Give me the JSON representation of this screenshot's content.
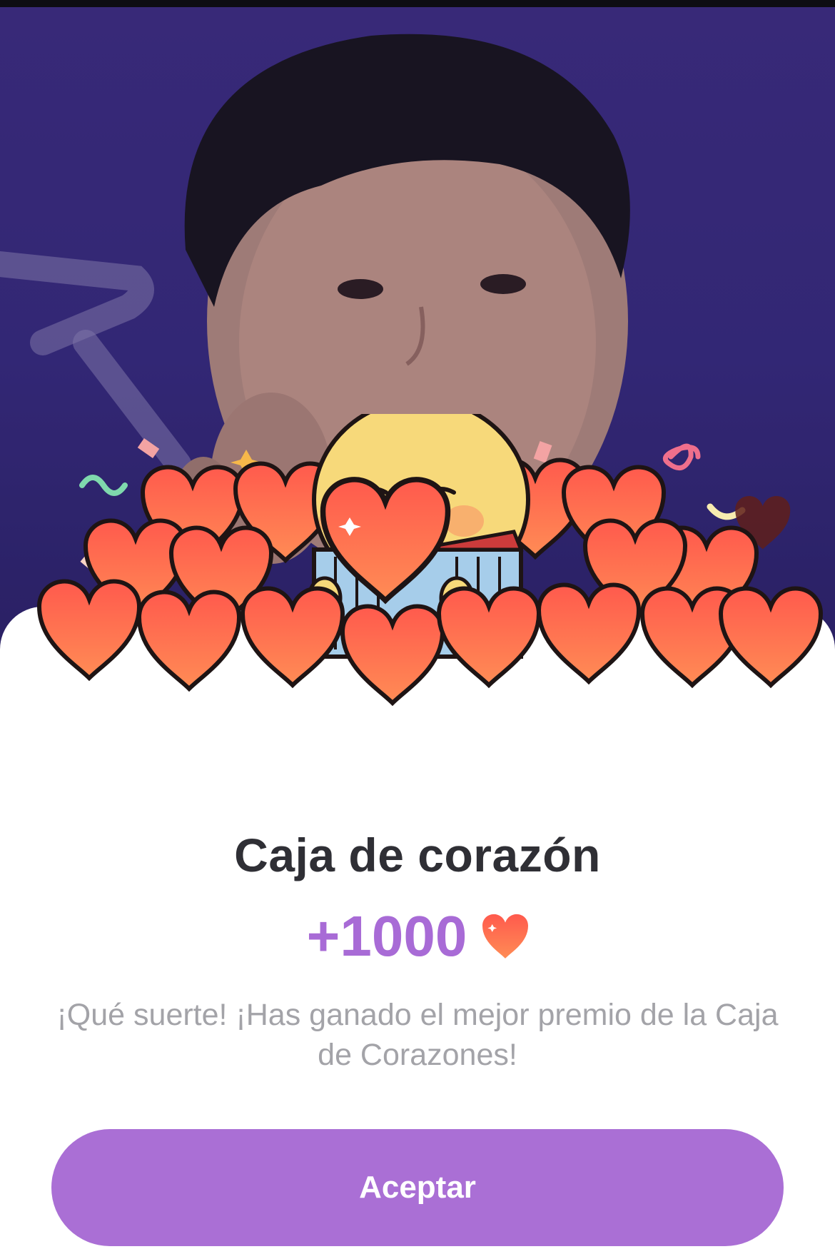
{
  "reward": {
    "title": "Caja de corazón",
    "amount": "+1000",
    "currency_icon": "heart-icon",
    "message": "¡Qué suerte! ¡Has ganado el mejor premio de la Caja de Corazones!"
  },
  "actions": {
    "accept_label": "Aceptar"
  },
  "illustration": {
    "mascot": "yellow-chick",
    "item": "heart-box",
    "background": "profile-photo"
  },
  "colors": {
    "accent": "#aa6fd5",
    "amount": "#a86bd6",
    "title": "#2f2f35",
    "message": "#a3a3a8",
    "heart": "#f4664a"
  }
}
